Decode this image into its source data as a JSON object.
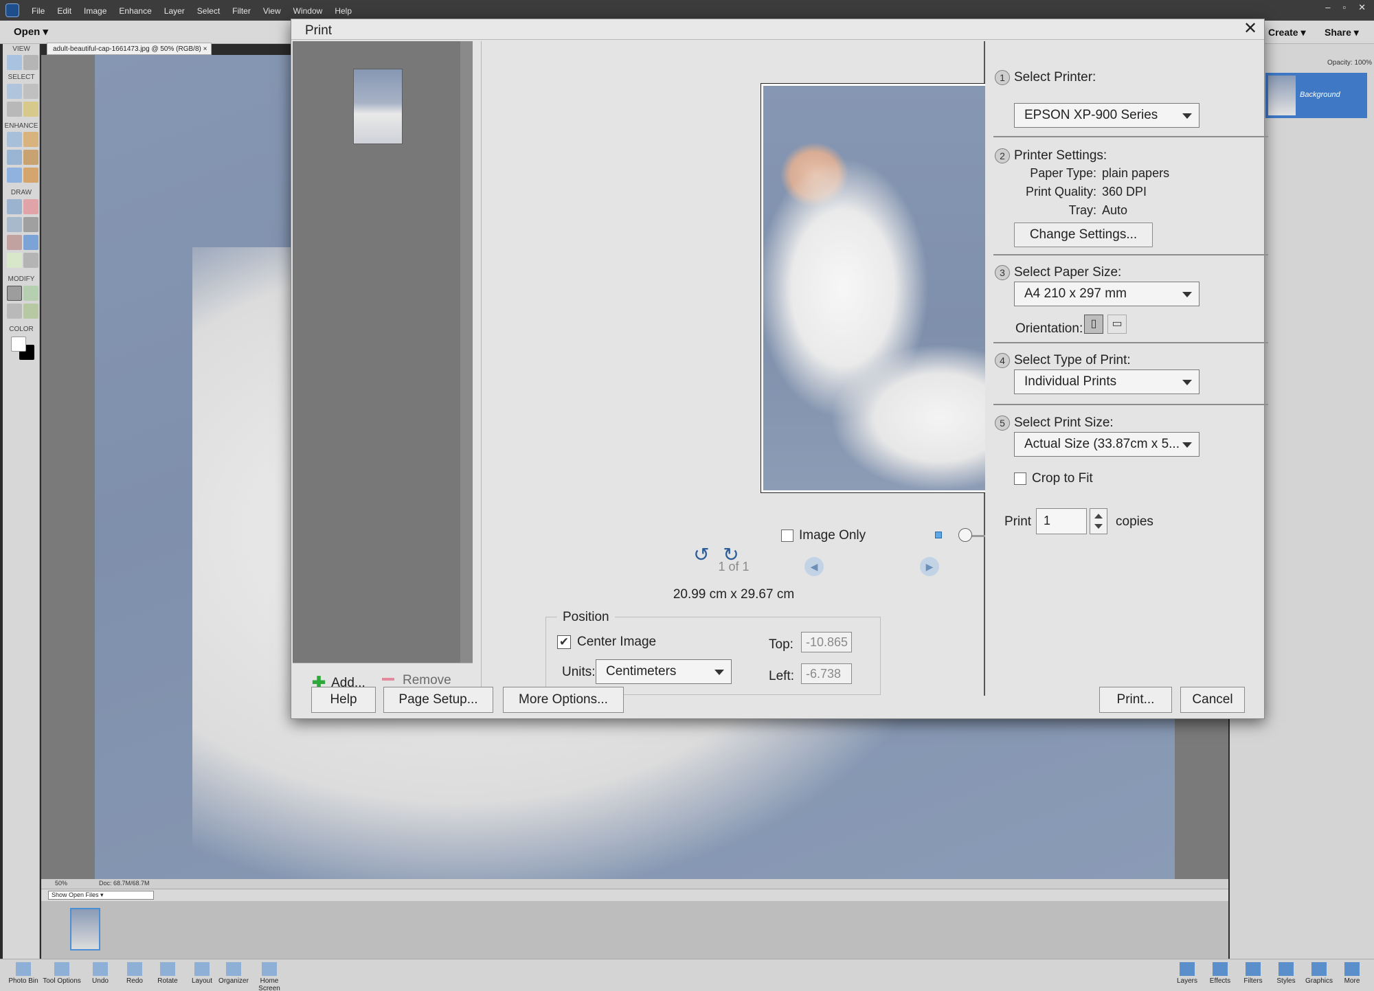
{
  "app": {
    "menu": [
      "File",
      "Edit",
      "Image",
      "Enhance",
      "Layer",
      "Select",
      "Filter",
      "View",
      "Window",
      "Help"
    ],
    "window_controls": [
      "–",
      "▫",
      "✕"
    ],
    "open_label": "Open",
    "create_label": "Create",
    "share_label": "Share",
    "doc_tab": "adult-beautiful-cap-1661473.jpg @ 50% (RGB/8)",
    "doc_tab_close": "×",
    "toolbox_sections": [
      "VIEW",
      "SELECT",
      "ENHANCE",
      "DRAW",
      "MODIFY",
      "COLOR"
    ],
    "zoom_status": "50%",
    "doc_status": "Doc: 68.7M/68.7M",
    "show_open_files": "Show Open Files",
    "opacity_label": "Opacity:",
    "opacity_value": "100%",
    "layer_name": "Background",
    "bottom_left": [
      {
        "label": "Photo Bin",
        "icon": "photo-bin-icon"
      },
      {
        "label": "Tool Options",
        "icon": "tool-options-icon"
      },
      {
        "label": "Undo",
        "icon": "undo-icon"
      },
      {
        "label": "Redo",
        "icon": "redo-icon"
      },
      {
        "label": "Rotate",
        "icon": "rotate-icon"
      },
      {
        "label": "Layout",
        "icon": "layout-icon"
      },
      {
        "label": "Organizer",
        "icon": "organizer-icon"
      },
      {
        "label": "Home Screen",
        "icon": "home-screen-icon"
      }
    ],
    "bottom_right": [
      {
        "label": "Layers",
        "icon": "layers-icon"
      },
      {
        "label": "Effects",
        "icon": "effects-icon"
      },
      {
        "label": "Filters",
        "icon": "filters-icon"
      },
      {
        "label": "Styles",
        "icon": "styles-icon"
      },
      {
        "label": "Graphics",
        "icon": "graphics-icon"
      },
      {
        "label": "More",
        "icon": "more-icon"
      }
    ]
  },
  "dialog": {
    "title": "Print",
    "close_glyph": "✕",
    "add_label": "Add...",
    "remove_label": "Remove",
    "image_only_label": "Image Only",
    "page_counter": "1 of 1",
    "dimensions": "20.99 cm x 29.67 cm",
    "position": {
      "legend": "Position",
      "center_image_label": "Center Image",
      "center_image_checked": true,
      "check_glyph": "✔",
      "units_label": "Units:",
      "units_value": "Centimeters",
      "top_label": "Top:",
      "top_value": "-10.865",
      "left_label": "Left:",
      "left_value": "-6.738"
    },
    "steps": [
      {
        "num": "1",
        "title": "Select Printer:"
      },
      {
        "num": "2",
        "title": "Printer Settings:"
      },
      {
        "num": "3",
        "title": "Select Paper Size:"
      },
      {
        "num": "4",
        "title": "Select Type of Print:"
      },
      {
        "num": "5",
        "title": "Select Print Size:"
      }
    ],
    "printer": "EPSON XP-900 Series",
    "printer_settings": {
      "paper_type_label": "Paper Type:",
      "paper_type": "plain papers",
      "print_quality_label": "Print Quality:",
      "print_quality": "360 DPI",
      "tray_label": "Tray:",
      "tray": "Auto",
      "change_button": "Change Settings..."
    },
    "paper_size": "A4 210 x 297 mm",
    "orientation_label": "Orientation:",
    "print_type": "Individual Prints",
    "print_size": "Actual Size (33.87cm x 5...",
    "crop_to_fit_label": "Crop to Fit",
    "crop_to_fit_checked": false,
    "print_label": "Print",
    "copies_value": "1",
    "copies_label": "copies",
    "footer": {
      "help": "Help",
      "page_setup": "Page Setup...",
      "more_options": "More Options...",
      "print": "Print...",
      "cancel": "Cancel"
    },
    "accent_color": "#2d5d97"
  }
}
